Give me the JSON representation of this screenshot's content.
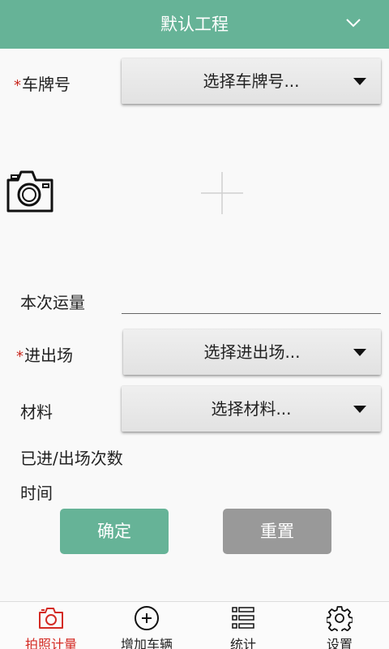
{
  "header": {
    "title": "默认工程",
    "icon": "chevron-down-icon"
  },
  "form": {
    "plate": {
      "required_mark": "*",
      "label": "车牌号",
      "value": "选择车牌号..."
    },
    "photo": {
      "camera_icon": "camera-icon",
      "slot_icon": "plus-icon"
    },
    "quantity": {
      "label": "本次运量",
      "value": ""
    },
    "direction": {
      "required_mark": "*",
      "label": "进出场",
      "value": "选择进出场..."
    },
    "material": {
      "label": "材料",
      "value": "选择材料..."
    },
    "count": {
      "label": "已进/出场次数"
    },
    "time": {
      "label": "时间"
    }
  },
  "buttons": {
    "confirm": "确定",
    "reset": "重置"
  },
  "nav": {
    "active_color": "#d42a23",
    "items": [
      {
        "label": "拍照计量",
        "icon": "camera-icon",
        "active": true
      },
      {
        "label": "增加车辆",
        "icon": "plus-circle-icon"
      },
      {
        "label": "统计",
        "icon": "list-icon"
      },
      {
        "label": "设置",
        "icon": "gear-icon"
      }
    ]
  },
  "colors": {
    "accent": "#66b397",
    "reset_button": "#999999",
    "required": "#c8281e"
  }
}
